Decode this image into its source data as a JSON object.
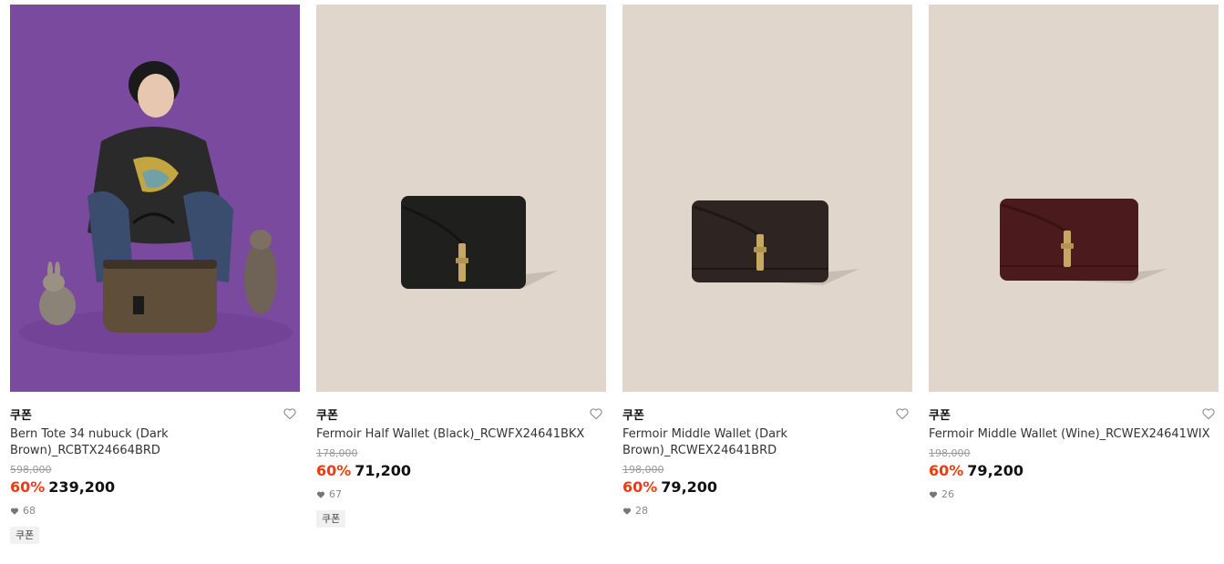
{
  "products": [
    {
      "brand": "쿠폰",
      "name": "Bern Tote 34 nubuck (Dark Brown)_RCBTX24664BRD",
      "original_price": "598,000",
      "discount": "60%",
      "price": "239,200",
      "likes": "68",
      "tag": "쿠폰",
      "image": "model-with-tote-bag-purple-background",
      "background_color": "#7a4a9e"
    },
    {
      "brand": "쿠폰",
      "name": "Fermoir Half Wallet (Black)_RCWFX24641BKX",
      "original_price": "178,000",
      "discount": "60%",
      "price": "71,200",
      "likes": "67",
      "tag": "쿠폰",
      "image": "black-half-wallet",
      "background_color": "#e0d6cc",
      "item_color": "#1f1f1d"
    },
    {
      "brand": "쿠폰",
      "name": "Fermoir Middle Wallet (Dark Brown)_RCWEX24641BRD",
      "original_price": "198,000",
      "discount": "60%",
      "price": "79,200",
      "likes": "28",
      "image": "dark-brown-middle-wallet",
      "background_color": "#e0d6cc",
      "item_color": "#2e2421"
    },
    {
      "brand": "쿠폰",
      "name": "Fermoir Middle Wallet (Wine)_RCWEX24641WIX",
      "original_price": "198,000",
      "discount": "60%",
      "price": "79,200",
      "likes": "26",
      "image": "wine-middle-wallet",
      "background_color": "#e0d6cc",
      "item_color": "#4a1a1c"
    }
  ],
  "colors": {
    "discount": "#ee3b0f",
    "original_price": "#9a9a9a"
  }
}
